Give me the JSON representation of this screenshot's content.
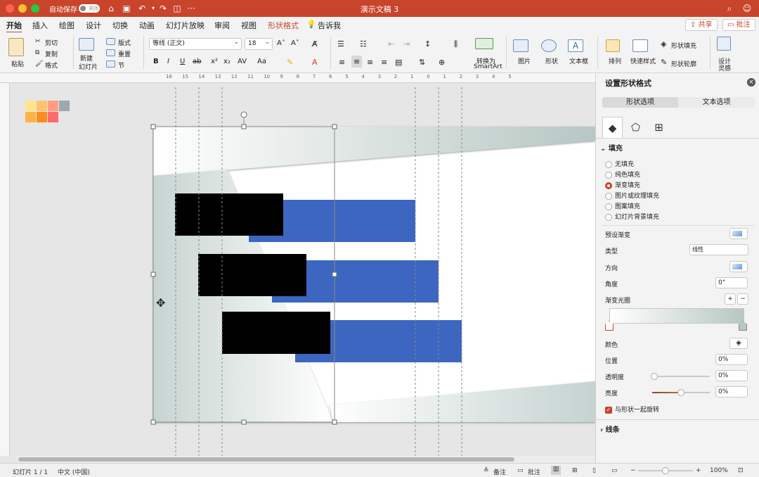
{
  "titlebar": {
    "autosave_label": "自动保存",
    "autosave_state": "关闭",
    "doc_title": "演示文稿 3"
  },
  "tabs": [
    "开始",
    "插入",
    "绘图",
    "设计",
    "切换",
    "动画",
    "幻灯片放映",
    "审阅",
    "视图",
    "形状格式",
    "告诉我"
  ],
  "tabs_right": {
    "share": "共享",
    "comments": "批注"
  },
  "ribbon": {
    "paste": "粘贴",
    "cut": "剪切",
    "copy": "复制",
    "format": "格式",
    "new_slide": "新建\n幻灯片",
    "new_slide_l1": "新建",
    "new_slide_l2": "幻灯片",
    "layout": "版式",
    "reset": "重置",
    "section": "节",
    "font_name": "等线 (正文)",
    "font_size": "18",
    "convert_smartart_l1": "转换为",
    "convert_smartart_l2": "SmartArt",
    "picture": "图片",
    "shape": "形状",
    "textbox": "文本框",
    "arrange": "排列",
    "quick_styles": "快速样式",
    "shape_fill": "形状填充",
    "shape_outline": "形状轮廓",
    "designer_l1": "设计",
    "designer_l2": "灵感"
  },
  "ruler_ticks": [
    "16",
    "15",
    "14",
    "13",
    "12",
    "11",
    "10",
    "9",
    "8",
    "7",
    "6",
    "5",
    "4",
    "3",
    "2",
    "1",
    "0",
    "1",
    "2",
    "3",
    "4",
    "5"
  ],
  "panel": {
    "title": "设置形状格式",
    "seg_shape": "形状选项",
    "seg_text": "文本选项",
    "fill_section": "填充",
    "fill_options": [
      "无填充",
      "纯色填充",
      "渐变填充",
      "图片或纹理填充",
      "图案填充",
      "幻灯片背景填充"
    ],
    "fill_selected": 2,
    "preset_gradient": "预设渐变",
    "type_label": "类型",
    "type_value": "线性",
    "direction_label": "方向",
    "angle_label": "角度",
    "angle_value": "0°",
    "stops_label": "渐变光圈",
    "color_label": "颜色",
    "position_label": "位置",
    "position_value": "0%",
    "transparency_label": "透明度",
    "transparency_value": "0%",
    "brightness_label": "亮度",
    "brightness_value": "0%",
    "rotate_with_shape": "与形状一起旋转",
    "line_section": "线条"
  },
  "status": {
    "slide_info": "幻灯片 1 / 1",
    "language": "中文 (中国)",
    "notes": "备注",
    "comments": "批注",
    "zoom": "100%"
  },
  "slide": {
    "palette": [
      "#ffe58a",
      "#ffc46b",
      "#ff9e80",
      "#9aa9b0",
      "#ffb347",
      "#ff8c1a",
      "#ff6b6b",
      "#e6e6e6"
    ]
  },
  "colors": {
    "accent": "#c8442b",
    "bar_blue": "#3c66c0",
    "black_block": "#000000"
  }
}
